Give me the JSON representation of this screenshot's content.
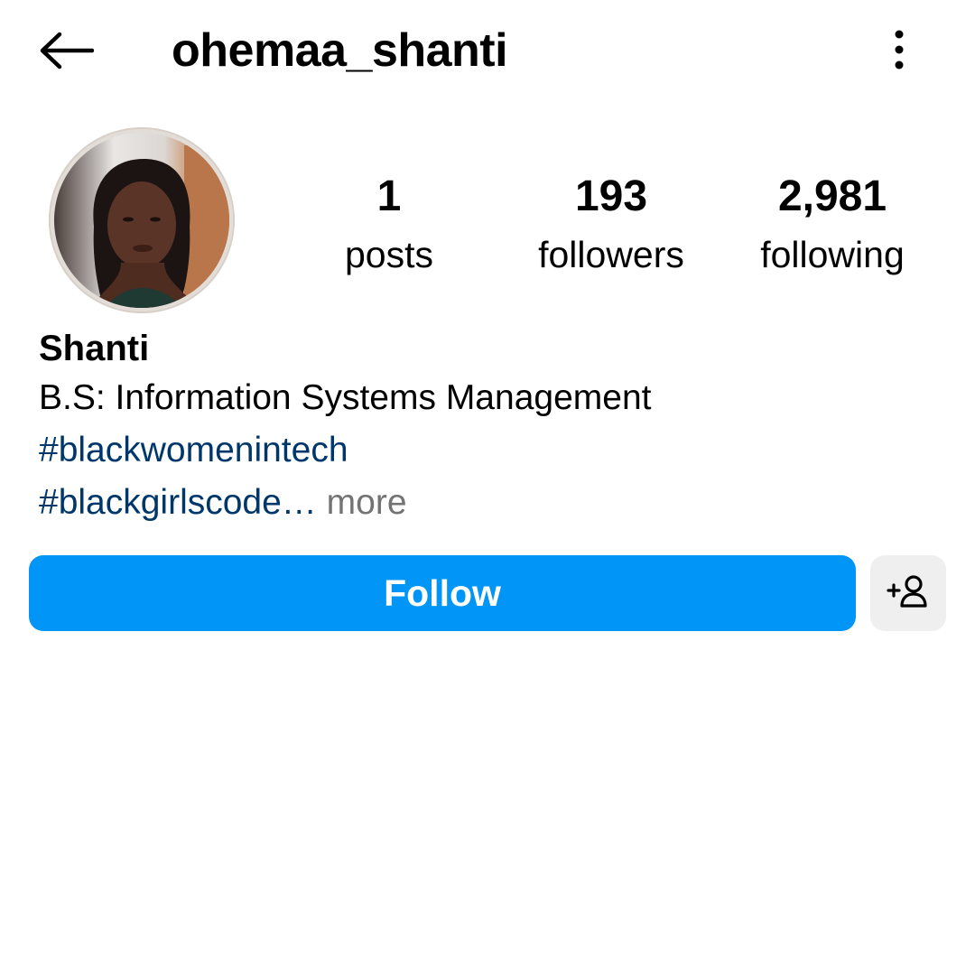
{
  "header": {
    "username": "ohemaa_shanti",
    "back_icon": "back-arrow-icon",
    "options_icon": "more-vertical-icon"
  },
  "profile": {
    "avatar_icon": "profile-photo",
    "stats": {
      "posts": {
        "value": "1",
        "label": "posts"
      },
      "followers": {
        "value": "193",
        "label": "followers"
      },
      "following": {
        "value": "2,981",
        "label": "following"
      }
    }
  },
  "bio": {
    "name": "Shanti",
    "line1": "B.S: Information Systems Management",
    "hashtag1": "#blackwomenintech",
    "hashtag2": "#blackgirlscode…",
    "more": " more"
  },
  "actions": {
    "follow_label": "Follow",
    "suggest_icon": "add-person-icon"
  },
  "colors": {
    "accent": "#0095f6",
    "hashtag": "#00376b",
    "muted": "#737373",
    "secondary_button": "#efefef"
  }
}
